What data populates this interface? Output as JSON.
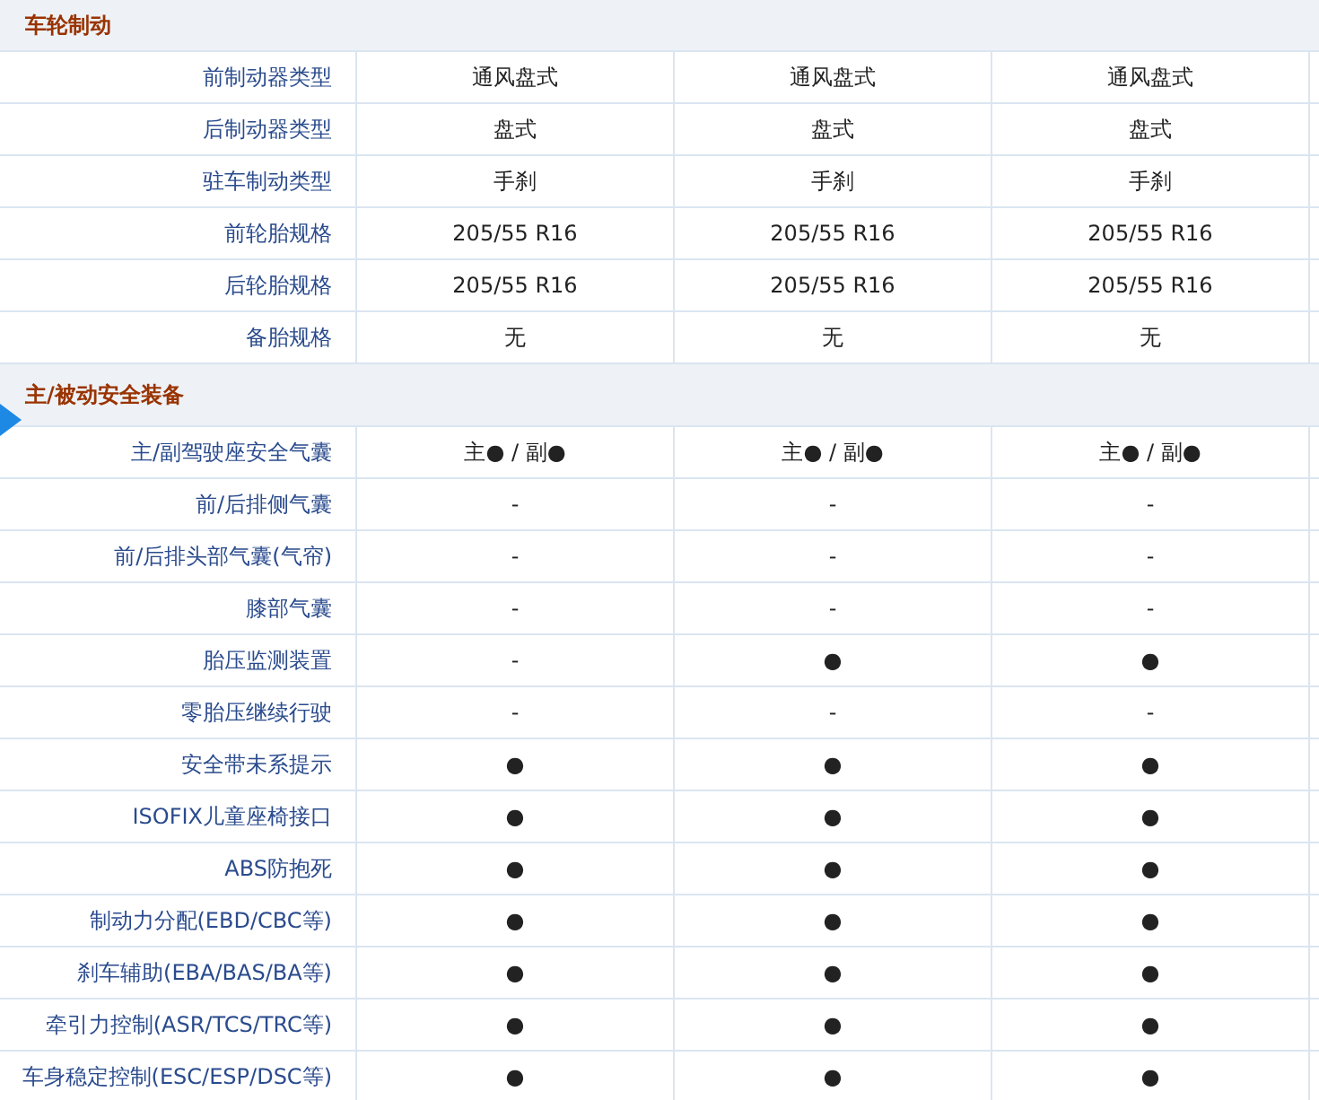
{
  "sections": [
    {
      "title": "车轮制动",
      "marker": false,
      "rows": [
        {
          "label": "前制动器类型",
          "values": [
            "通风盘式",
            "通风盘式",
            "通风盘式"
          ]
        },
        {
          "label": "后制动器类型",
          "values": [
            "盘式",
            "盘式",
            "盘式"
          ]
        },
        {
          "label": "驻车制动类型",
          "values": [
            "手刹",
            "手刹",
            "手刹"
          ]
        },
        {
          "label": "前轮胎规格",
          "values": [
            "205/55 R16",
            "205/55 R16",
            "205/55 R16"
          ]
        },
        {
          "label": "后轮胎规格",
          "values": [
            "205/55 R16",
            "205/55 R16",
            "205/55 R16"
          ]
        },
        {
          "label": "备胎规格",
          "values": [
            "无",
            "无",
            "无"
          ]
        }
      ]
    },
    {
      "title": "主/被动安全装备",
      "marker": true,
      "rows": [
        {
          "label": "主/副驾驶座安全气囊",
          "values": [
            "主● / 副●",
            "主● / 副●",
            "主● / 副●"
          ]
        },
        {
          "label": "前/后排侧气囊",
          "values": [
            "-",
            "-",
            "-"
          ]
        },
        {
          "label": "前/后排头部气囊(气帘)",
          "values": [
            "-",
            "-",
            "-"
          ]
        },
        {
          "label": "膝部气囊",
          "values": [
            "-",
            "-",
            "-"
          ]
        },
        {
          "label": "胎压监测装置",
          "values": [
            "-",
            "●",
            "●"
          ]
        },
        {
          "label": "零胎压继续行驶",
          "values": [
            "-",
            "-",
            "-"
          ]
        },
        {
          "label": "安全带未系提示",
          "values": [
            "●",
            "●",
            "●"
          ]
        },
        {
          "label": "ISOFIX儿童座椅接口",
          "values": [
            "●",
            "●",
            "●"
          ]
        },
        {
          "label": "ABS防抱死",
          "values": [
            "●",
            "●",
            "●"
          ]
        },
        {
          "label": "制动力分配(EBD/CBC等)",
          "values": [
            "●",
            "●",
            "●"
          ]
        },
        {
          "label": "刹车辅助(EBA/BAS/BA等)",
          "values": [
            "●",
            "●",
            "●"
          ]
        },
        {
          "label": "牵引力控制(ASR/TCS/TRC等)",
          "values": [
            "●",
            "●",
            "●"
          ]
        },
        {
          "label": "车身稳定控制(ESC/ESP/DSC等)",
          "values": [
            "●",
            "●",
            "●"
          ]
        }
      ]
    }
  ]
}
